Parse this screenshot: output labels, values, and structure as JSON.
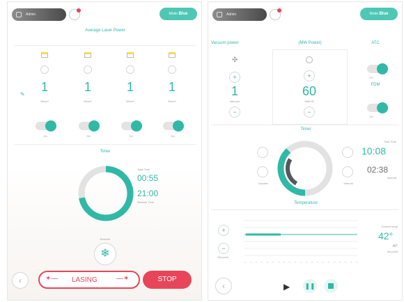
{
  "left": {
    "user": "Admin",
    "mode_prefix": "Mode",
    "mode_bold": "Blue",
    "title": "Average Laser Power",
    "channels": [
      {
        "value": "1",
        "unit": "W/cm²",
        "toggle": "On"
      },
      {
        "value": "1",
        "unit": "W/cm²",
        "toggle": "On"
      },
      {
        "value": "1",
        "unit": "W/cm²",
        "toggle": "On"
      },
      {
        "value": "1",
        "unit": "W/cm²",
        "toggle": "On"
      }
    ],
    "timer_title": "Timer",
    "timer_progress": 0.72,
    "total_label": "Total Time",
    "total_value": "00:55",
    "session_value": "21:00",
    "session_label": "Session Time",
    "scanner_label": "Scanner",
    "lasing_label": "LASING",
    "stop_label": "STOP",
    "colors": {
      "accent": "#2fb9a6",
      "danger": "#e8455a"
    }
  },
  "right": {
    "user": "Admin",
    "mode_prefix": "Mode",
    "mode_bold": "Blue",
    "vacuum_title": "Vacuum power",
    "vacuum_value": "1",
    "vacuum_unit": "Vacuum",
    "mw_title": "(MW Power)",
    "mw_value": "60",
    "mw_unit": "Watt W",
    "atc_title": "ATC",
    "atc_toggle": "On",
    "fdm_title": "FDM",
    "fdm_toggle": "On",
    "timer_title": "Timer",
    "timer_progress": 0.38,
    "total_label": "Total Time",
    "total_value": "10:08",
    "session_value": "02:38",
    "session_label": "Interval",
    "left_small": "Inactive",
    "right_small": "Interval",
    "temp_title": "Temperature",
    "current_temp_label": "Current temp",
    "current_temp": "42°",
    "set_temp": "40°",
    "set_point_label": "set point",
    "set_point_left": "Set point",
    "plus": "+",
    "minus": "−"
  }
}
